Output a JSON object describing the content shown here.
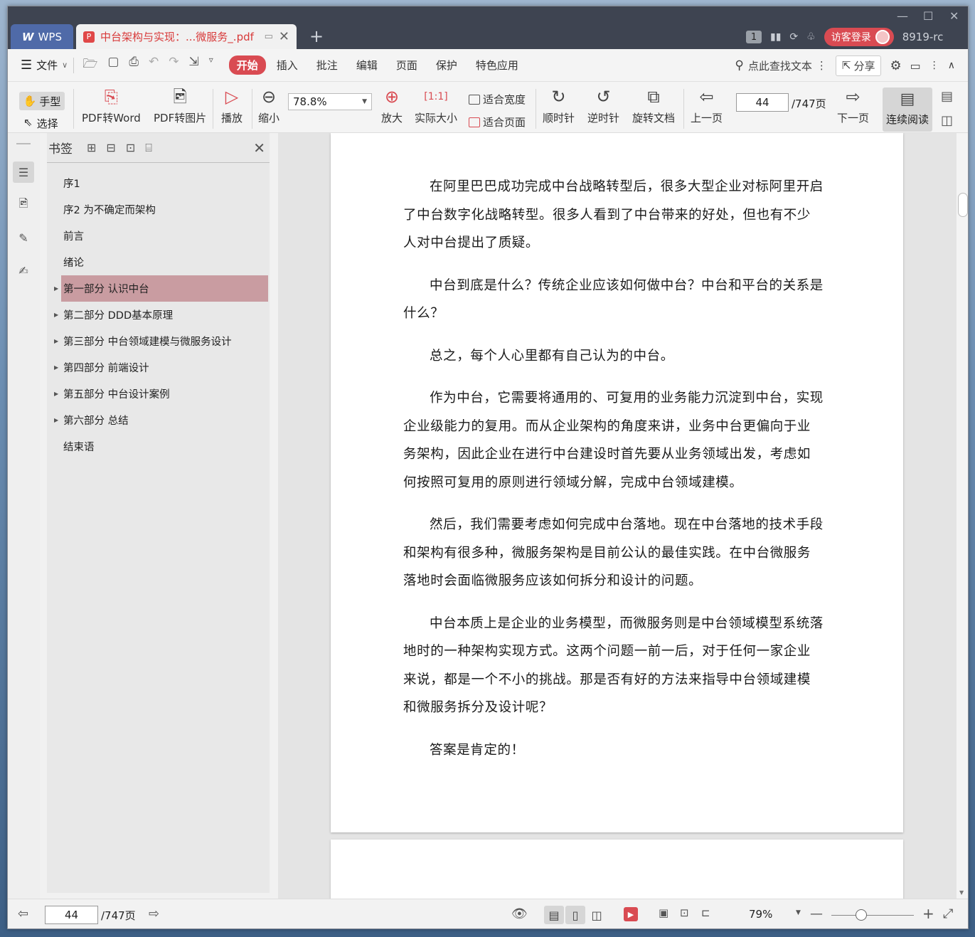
{
  "titlebar": {
    "app_name": "WPS",
    "doc_tab_title": "中台架构与实现：...微服务_.pdf",
    "new_tab": "+",
    "badge": "1",
    "login_label": "访客登录",
    "user_id": "8919-rc"
  },
  "menubar": {
    "file_label": "文件",
    "tabs": [
      "开始",
      "插入",
      "批注",
      "编辑",
      "页面",
      "保护",
      "特色应用"
    ],
    "active_tab": "开始",
    "search_label": "点此查找文本",
    "share_label": "分享"
  },
  "toolbar": {
    "hand_label": "手型",
    "select_label": "选择",
    "pdf_to_word": "PDF转Word",
    "pdf_to_image": "PDF转图片",
    "play": "播放",
    "zoom_out": "缩小",
    "zoom_value": "78.8%",
    "zoom_in": "放大",
    "actual_size": "实际大小",
    "fit_width": "适合宽度",
    "fit_page": "适合页面",
    "clockwise": "顺时针",
    "counter_clockwise": "逆时针",
    "rotate_doc": "旋转文档",
    "prev_page": "上一页",
    "current_page": "44",
    "total_pages": "/747页",
    "next_page": "下一页",
    "continuous_read": "连续阅读"
  },
  "bookmarks": {
    "title": "书签",
    "items": [
      {
        "label": "序1",
        "expandable": false,
        "selected": false
      },
      {
        "label": "序2 为不确定而架构",
        "expandable": false,
        "selected": false
      },
      {
        "label": "前言",
        "expandable": false,
        "selected": false
      },
      {
        "label": "绪论",
        "expandable": false,
        "selected": false
      },
      {
        "label": "第一部分 认识中台",
        "expandable": true,
        "selected": true
      },
      {
        "label": "第二部分 DDD基本原理",
        "expandable": true,
        "selected": false
      },
      {
        "label": "第三部分 中台领域建模与微服务设计",
        "expandable": true,
        "selected": false
      },
      {
        "label": "第四部分 前端设计",
        "expandable": true,
        "selected": false
      },
      {
        "label": "第五部分 中台设计案例",
        "expandable": true,
        "selected": false
      },
      {
        "label": "第六部分 总结",
        "expandable": true,
        "selected": false
      },
      {
        "label": "结束语",
        "expandable": false,
        "selected": false
      }
    ]
  },
  "document": {
    "paragraphs": [
      "在阿里巴巴成功完成中台战略转型后，很多大型企业对标阿里开启了中台数字化战略转型。很多人看到了中台带来的好处，但也有不少人对中台提出了质疑。",
      "中台到底是什么？传统企业应该如何做中台？中台和平台的关系是什么？",
      "总之，每个人心里都有自己认为的中台。",
      "作为中台，它需要将通用的、可复用的业务能力沉淀到中台，实现企业级能力的复用。而从企业架构的角度来讲，业务中台更偏向于业务架构，因此企业在进行中台建设时首先要从业务领域出发，考虑如何按照可复用的原则进行领域分解，完成中台领域建模。",
      "然后，我们需要考虑如何完成中台落地。现在中台落地的技术手段和架构有很多种，微服务架构是目前公认的最佳实践。在中台微服务落地时会面临微服务应该如何拆分和设计的问题。",
      "中台本质上是企业的业务模型，而微服务则是中台领域模型系统落地时的一种架构实现方式。这两个问题一前一后，对于任何一家企业来说，都是一个不小的挑战。那是否有好的方法来指导中台领域建模和微服务拆分及设计呢？",
      "答案是肯定的！"
    ]
  },
  "statusbar": {
    "current_page": "44",
    "total_pages": "/747页",
    "zoom": "79%"
  },
  "colors": {
    "accent": "#d94b52",
    "selection": "#c99ca1",
    "titlebar": "#3e4451"
  }
}
